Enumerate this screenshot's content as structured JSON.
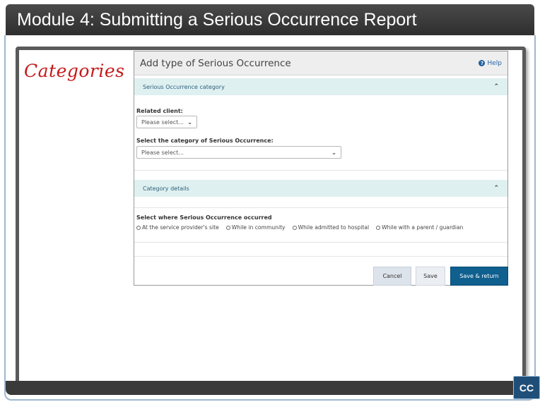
{
  "slide": {
    "title": "Module 4:  Submitting a Serious Occurrence Report",
    "annotation": "Categories",
    "cc_label": "CC"
  },
  "dialog": {
    "title": "Add type of Serious Occurrence",
    "help_label": "Help",
    "section1": {
      "header": "Serious Occurrence category",
      "related_client_label": "Related client:",
      "related_client_value": "Please select...",
      "category_label": "Select the category of Serious Occurrence:",
      "category_value": "Please select..."
    },
    "section2": {
      "header": "Category details",
      "where_label": "Select where Serious Occurrence occurred",
      "options": [
        "At the service provider's site",
        "While in community",
        "While admitted to hospital",
        "While with a parent / guardian"
      ]
    },
    "buttons": {
      "cancel": "Cancel",
      "save": "Save",
      "save_return": "Save & return"
    }
  },
  "colors": {
    "annotation": "#c41a1a",
    "section_header_bg": "#dff0f0",
    "primary_button": "#0f5f8f",
    "title_bar": "#3a3a3a"
  },
  "icons": {
    "help": "help-circle-icon",
    "section_toggle": "chevron-up-icon",
    "select": "chevron-down-icon"
  }
}
